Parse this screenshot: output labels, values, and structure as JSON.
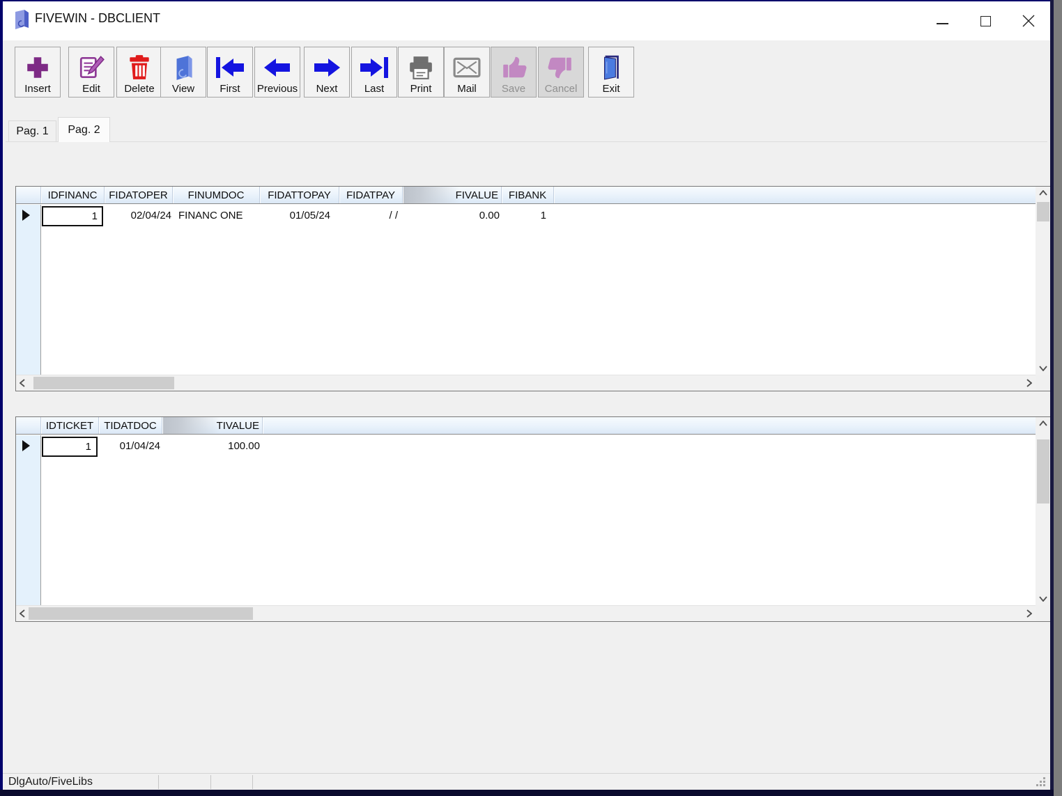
{
  "window": {
    "title": "FIVEWIN - DBCLIENT"
  },
  "titlebar": {
    "controls": [
      "minimize",
      "maximize",
      "close"
    ]
  },
  "toolbar": {
    "buttons": [
      {
        "label": "Insert",
        "icon": "plus-icon",
        "enabled": true
      },
      {
        "label": "Edit",
        "icon": "notepad-pencil-icon",
        "enabled": true
      },
      {
        "label": "Delete",
        "icon": "trash-icon",
        "enabled": true
      },
      {
        "label": "View",
        "icon": "book-icon",
        "enabled": true
      },
      {
        "label": "First",
        "icon": "arrow-first-icon",
        "enabled": true
      },
      {
        "label": "Previous",
        "icon": "arrow-left-icon",
        "enabled": true
      },
      {
        "label": "Next",
        "icon": "arrow-right-icon",
        "enabled": true
      },
      {
        "label": "Last",
        "icon": "arrow-last-icon",
        "enabled": true
      },
      {
        "label": "Print",
        "icon": "printer-icon",
        "enabled": true
      },
      {
        "label": "Mail",
        "icon": "envelope-icon",
        "enabled": true
      },
      {
        "label": "Save",
        "icon": "thumbs-up-icon",
        "enabled": false
      },
      {
        "label": "Cancel",
        "icon": "thumbs-down-icon",
        "enabled": false
      },
      {
        "label": "Exit",
        "icon": "door-icon",
        "enabled": true
      }
    ]
  },
  "tabs": [
    {
      "label": "Pag. 1",
      "active": false
    },
    {
      "label": "Pag. 2",
      "active": true
    }
  ],
  "grids": {
    "financ": {
      "headers": [
        "IDFINANC",
        "FIDATOPER",
        "FINUMDOC",
        "FIDATTOPAY",
        "FIDATPAY",
        "FIVALUE",
        "FIBANK"
      ],
      "row": [
        "1",
        "02/04/24",
        "FINANC ONE",
        "01/05/24",
        "/ /",
        "0.00",
        "1"
      ]
    },
    "ticket": {
      "headers": [
        "IDTICKET",
        "TIDATDOC",
        "TIVALUE"
      ],
      "row": [
        "1",
        "01/04/24",
        "100.00"
      ]
    }
  },
  "statusbar": {
    "text": "DlgAuto/FiveLibs"
  },
  "colors": {
    "window_border": "#02026b",
    "titlebar_bg": "#ffffff",
    "app_bg": "#f0f0f0",
    "header_gradient_top": "#f7fbfe",
    "header_gradient_bottom": "#dbe8f6",
    "selector_strip": "#e4f1fc",
    "icon_purple": "#7d2a85",
    "icon_red": "#e01b1b",
    "icon_blue": "#1414e0",
    "icon_gray": "#6f6f6f",
    "disabled_plum": "#c288c2",
    "door_blue": "#4b7be0",
    "scroll_thumb": "#cdcdcd"
  }
}
